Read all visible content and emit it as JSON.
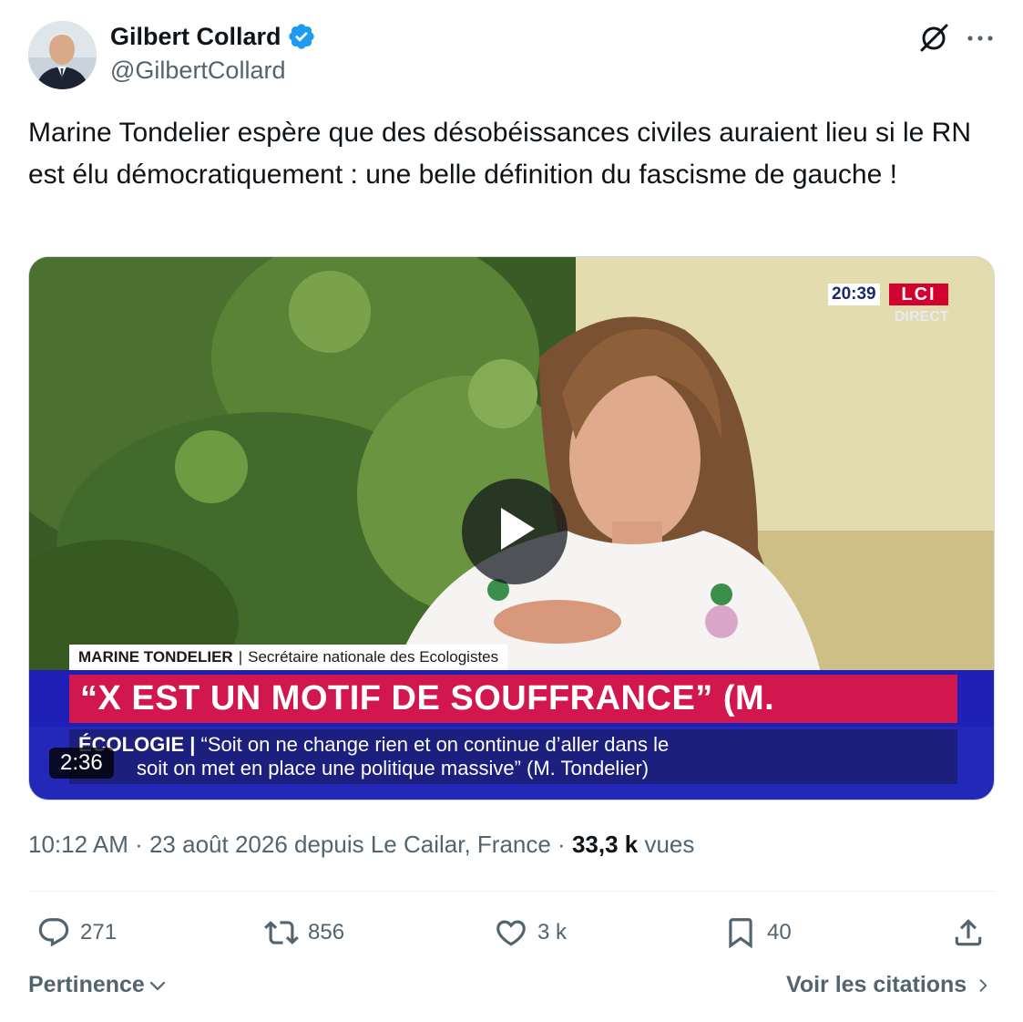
{
  "author": {
    "display_name": "Gilbert Collard",
    "handle": "@GilbertCollard",
    "verified": true
  },
  "tweet": {
    "text": "Marine Tondelier espère que des désobéissances civiles auraient lieu si le RN est élu démocratiquement : une belle définition du fascisme de gauche !"
  },
  "video": {
    "duration": "2:36",
    "overlay": {
      "clock": "20:39",
      "channel": "LCI",
      "live_label": "DIRECT",
      "speaker_name": "MARINE TONDELIER",
      "speaker_separator": "|",
      "speaker_title": "Secrétaire nationale des Ecologistes",
      "headline": "“X EST UN MOTIF DE SOUFFRANCE” (M. TONDELIER)",
      "ticker_tag": "ÉCOLOGIE |",
      "ticker_line1": "“Soit on ne change rien et on continue d’aller dans le",
      "ticker_line2": "soit on met en place une politique massive” (M. Tondelier)"
    }
  },
  "meta": {
    "time": "10:12 AM",
    "sep1": " · ",
    "date_place": "23 août 2026 depuis Le Cailar, France",
    "sep2": " · ",
    "views_count": "33,3 k",
    "views_label": "vues"
  },
  "actions": {
    "replies": "271",
    "reposts": "856",
    "likes": "3 k",
    "bookmarks": "40"
  },
  "footer": {
    "sort_label": "Pertinence",
    "quotes_link": "Voir les citations"
  },
  "colors": {
    "verified_blue": "#1d9bf0",
    "secondary_text": "#536471",
    "primary_text": "#0f1419",
    "headline_red": "#d2174f",
    "ticker_blue": "#1d1f7e"
  },
  "icons": [
    "verified-badge-icon",
    "grok-icon",
    "more-icon",
    "play-icon",
    "reply-icon",
    "repost-icon",
    "like-icon",
    "bookmark-icon",
    "share-icon",
    "chevron-down-icon",
    "chevron-right-icon"
  ]
}
